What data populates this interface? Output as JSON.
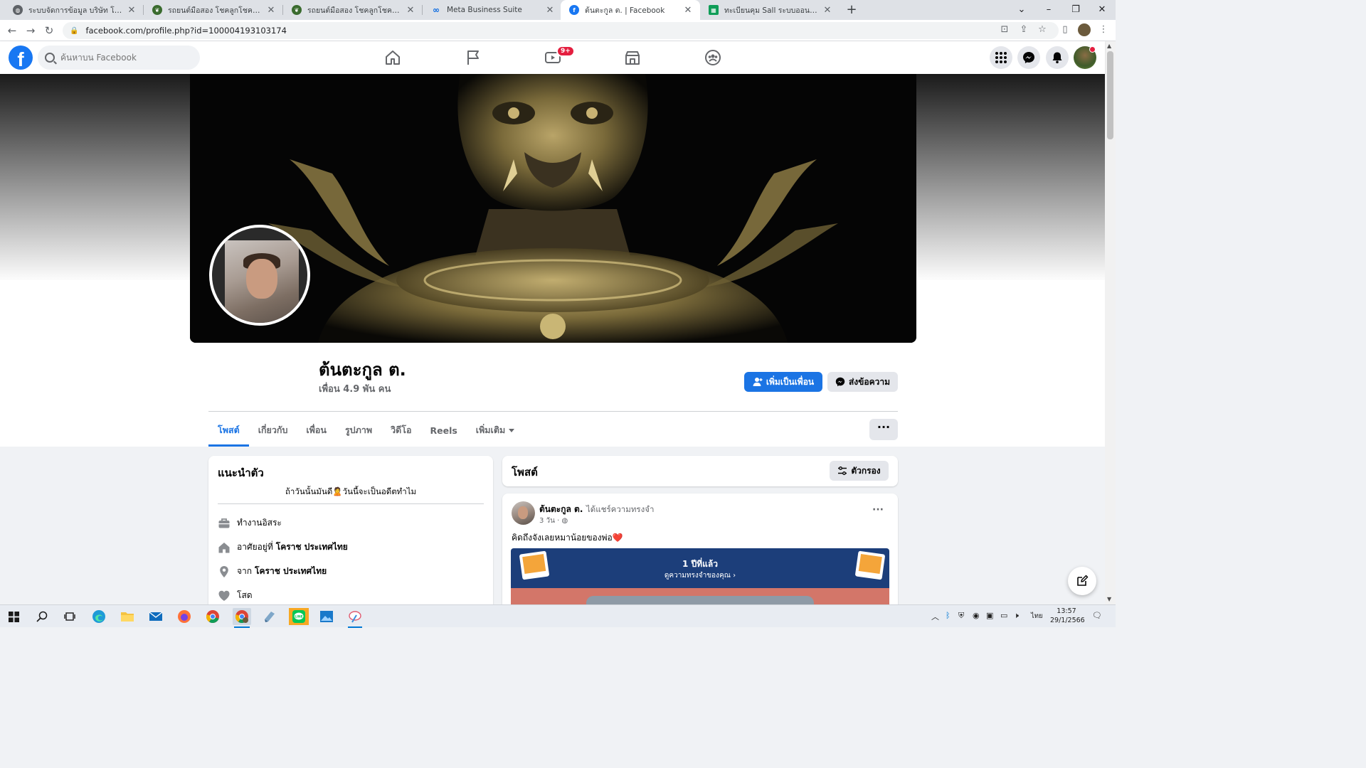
{
  "browser": {
    "tabs": [
      {
        "title": "ระบบจัดการข้อมูล บริษัท โชคลูกโชค อุดรธานี",
        "favicon": "globe",
        "fav_color": "#5f6368"
      },
      {
        "title": "รถยนต์มือสอง โชคลูกโชค อุดรธานี",
        "favicon": "leaf",
        "fav_color": "#3a6b2e"
      },
      {
        "title": "รถยนต์มือสอง โชคลูกโชค อุดรธานี",
        "favicon": "leaf",
        "fav_color": "#3a6b2e"
      },
      {
        "title": "Meta Business Suite",
        "favicon": "meta",
        "fav_color": "#0668e1"
      },
      {
        "title": "ต้นตะกูล ต. | Facebook",
        "favicon": "facebook",
        "fav_color": "#1877f2"
      },
      {
        "title": "ทะเบียนคุม Sall ระบบออนไลน์.xlsx - Google ชีต",
        "favicon": "sheets",
        "fav_color": "#0f9d58"
      }
    ],
    "active_tab": 4,
    "new_tab": "+",
    "url": "facebook.com/profile.php?id=100004193103174"
  },
  "fb_nav": {
    "logo": "f",
    "search_placeholder": "ค้นหาบน Facebook",
    "watch_badge": "9+"
  },
  "profile": {
    "name": "ต้นตะกูล ต.",
    "friends": "เพื่อน 4.9 พัน คน",
    "add_friend_label": "เพิ่มเป็นเพื่อน",
    "message_label": "ส่งข้อความ",
    "more_label": "···",
    "tabs": [
      {
        "label": "โพสต์"
      },
      {
        "label": "เกี่ยวกับ"
      },
      {
        "label": "เพื่อน"
      },
      {
        "label": "รูปภาพ"
      },
      {
        "label": "วิดีโอ"
      },
      {
        "label": "Reels"
      },
      {
        "label": "เพิ่มเติม"
      }
    ]
  },
  "intro": {
    "title": "แนะนำตัว",
    "bio": "ถ้าวันนั้นมันดี🙎วันนี้จะเป็นอดีตทำไม",
    "work": "ทำงานอิสระ",
    "lives_prefix": "อาศัยอยู่ที่",
    "lives_place": "โคราช ประเทศไทย",
    "from_prefix": "จาก",
    "from_place": "โคราช ประเทศไทย",
    "relationship": "โสด"
  },
  "posts": {
    "title": "โพสต์",
    "filter_label": "ตัวกรอง",
    "items": [
      {
        "author": "ต้นตะกูล ต.",
        "action": "ได้แชร์ความทรงจำ",
        "time": "3 วัน ·",
        "text": "คิดถึงจังเลยหมาน้อยของพ่อ❤️",
        "memory_title": "1 ปีที่แล้ว",
        "memory_sub": "ดูความทรงจำของคุณ ›"
      }
    ]
  },
  "taskbar": {
    "lang": "ไทย",
    "time": "13:57",
    "date": "29/1/2566"
  }
}
